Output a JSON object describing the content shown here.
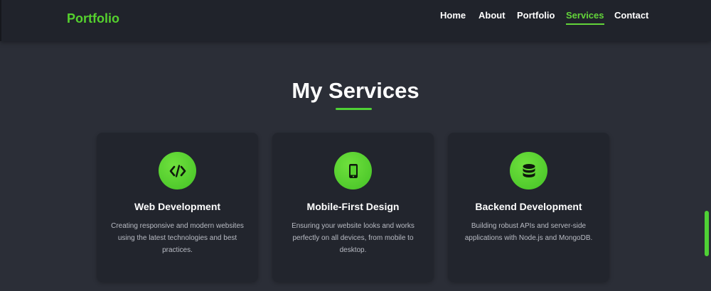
{
  "brand": "Portfolio",
  "nav": {
    "items": [
      {
        "label": "Home"
      },
      {
        "label": "About"
      },
      {
        "label": "Portfolio"
      },
      {
        "label": "Services"
      },
      {
        "label": "Contact"
      }
    ],
    "active": "Services"
  },
  "section": {
    "title": "My Services"
  },
  "services": [
    {
      "icon": "code-icon",
      "title": "Web Development",
      "description": "Creating responsive and modern websites using the latest technologies and best practices."
    },
    {
      "icon": "mobile-icon",
      "title": "Mobile-First Design",
      "description": "Ensuring your website looks and works perfectly on all devices, from mobile to desktop."
    },
    {
      "icon": "database-icon",
      "title": "Backend Development",
      "description": "Building robust APIs and server-side applications with Node.js and MongoDB."
    }
  ],
  "colors": {
    "accent": "#55d12e",
    "background": "#2b2e37",
    "navbar": "#20232b",
    "card": "#22252d"
  }
}
